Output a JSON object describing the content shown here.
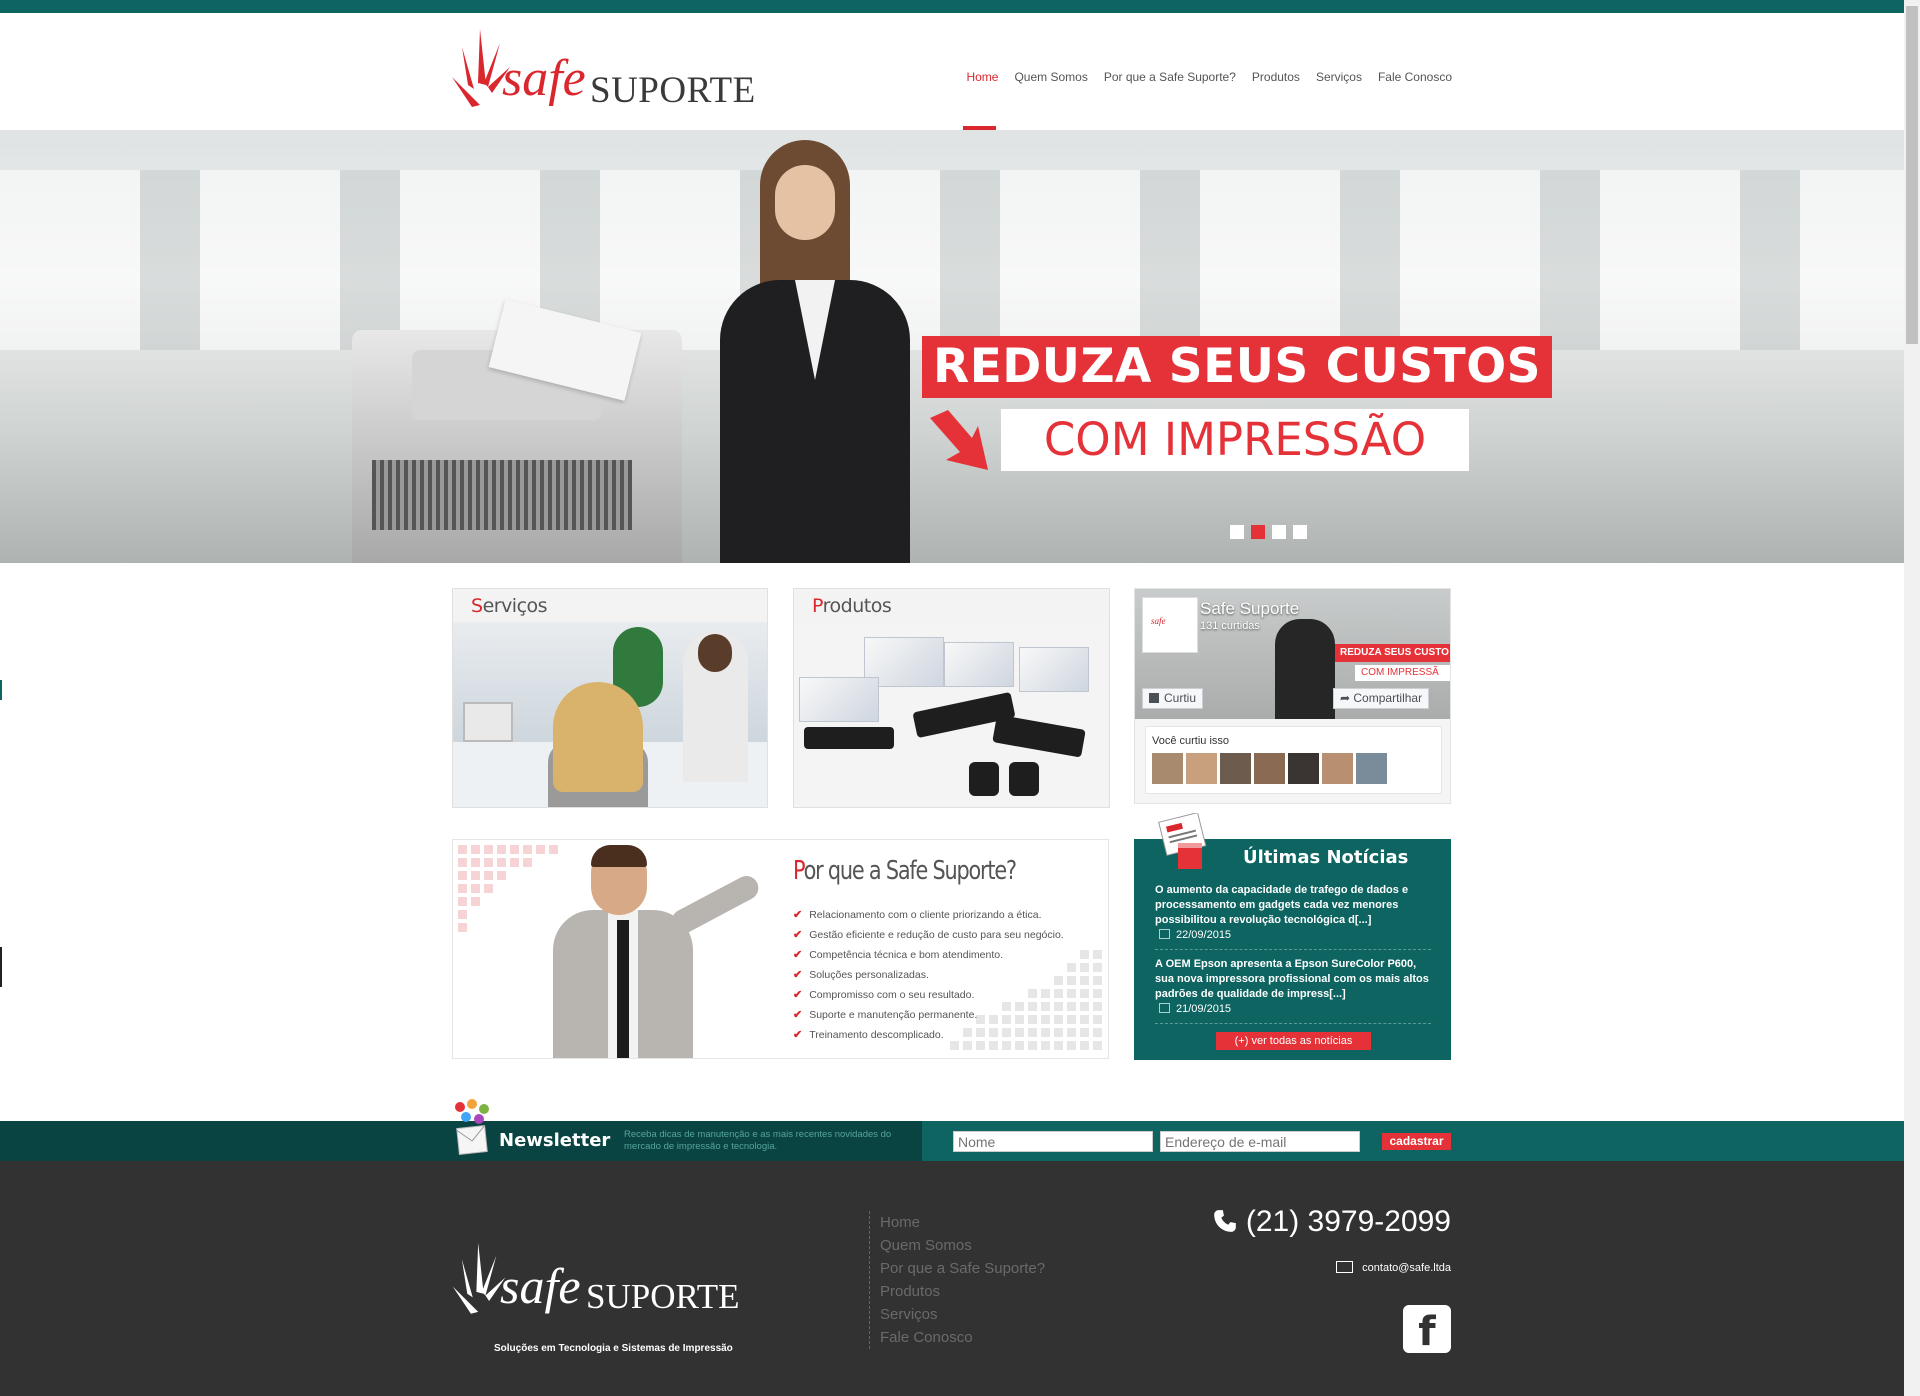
{
  "brand": {
    "name_part1": "safe",
    "name_part2": "SUPORTE",
    "tagline": "Soluções em Tecnologia e Sistemas de Impressão",
    "primary_color": "#d9272d",
    "teal_color": "#0d6461"
  },
  "nav": {
    "items": [
      {
        "label": "Home",
        "active": true
      },
      {
        "label": "Quem Somos"
      },
      {
        "label": "Por que a Safe Suporte?"
      },
      {
        "label": "Produtos"
      },
      {
        "label": "Serviços"
      },
      {
        "label": "Fale Conosco"
      }
    ]
  },
  "hero": {
    "headline": "REDUZA SEUS CUSTOS",
    "subheadline": "COM IMPRESSÃO",
    "slides_count": 4,
    "active_slide": 2
  },
  "cards": {
    "services": {
      "title_first": "S",
      "title_rest": "erviços"
    },
    "products": {
      "title_first": "P",
      "title_rest": "rodutos"
    }
  },
  "facebook": {
    "page_name": "Safe Suporte",
    "likes": "131 curtidas",
    "like_button": "Curtiu",
    "share_button": "Compartilhar",
    "cover_line1": "REDUZA SEUS CUSTO",
    "cover_line2": "COM IMPRESSÃ",
    "friends_label": "Você curtiu isso",
    "faces_count": 7
  },
  "why": {
    "title_first": "P",
    "title_rest": "or que a Safe Suporte?",
    "items": [
      "Relacionamento com o cliente priorizando a ética.",
      "Gestão eficiente e redução de custo para seu negócio.",
      "Competência técnica e bom atendimento.",
      "Soluções personalizadas.",
      "Compromisso com o seu resultado.",
      "Suporte e manutenção permanente.",
      "Treinamento descomplicado."
    ]
  },
  "news": {
    "title": "Últimas Notícias",
    "items": [
      {
        "text": "O aumento da capacidade de trafego de dados e processamento em gadgets cada vez menores possibilitou a revolução tecnológica d[...]",
        "date": "22/09/2015"
      },
      {
        "text": "A OEM Epson apresenta a Epson SureColor P600, sua nova impressora profissional com os mais altos padrões de qualidade de impress[...]",
        "date": "21/09/2015"
      }
    ],
    "more_label": "(+) ver todas as notícias"
  },
  "newsletter": {
    "title": "Newsletter",
    "description": "Receba dicas de manutenção e as mais recentes novidades do mercado de impressão e tecnologia.",
    "name_placeholder": "Nome",
    "email_placeholder": "Endereço de e-mail",
    "submit_label": "cadastrar"
  },
  "footer": {
    "links": [
      "Home",
      "Quem Somos",
      "Por que a Safe Suporte?",
      "Produtos",
      "Serviços",
      "Fale Conosco"
    ],
    "phone": "(21) 3979-2099",
    "email": "contato@safe.ltda",
    "facebook_glyph": "f"
  }
}
